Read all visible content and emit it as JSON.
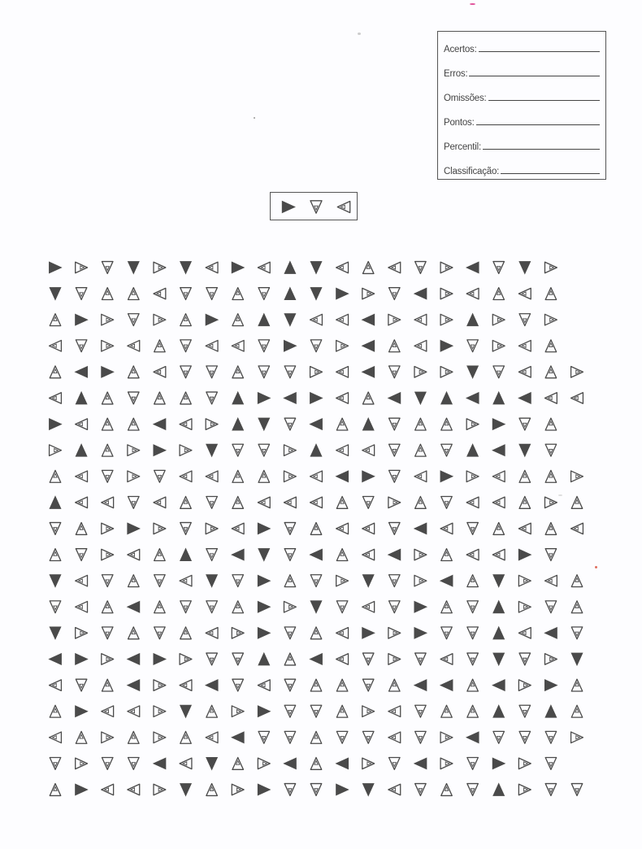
{
  "score_sheet": {
    "fields": [
      {
        "label": "Acertos:"
      },
      {
        "label": "Erros:"
      },
      {
        "label": "Omissões:"
      },
      {
        "label": "Pontos:"
      },
      {
        "label": "Percentil:"
      },
      {
        "label": "Classificação:"
      }
    ]
  },
  "colors": {
    "ink": "#4a4a4a",
    "paper": "#fdfdff",
    "border": "#555555"
  },
  "icon_legend": {
    "R": "filled-right-triangle",
    "L": "filled-left-triangle",
    "U": "filled-up-triangle",
    "D": "filled-down-triangle",
    "r": "outline-right-triangle-with-dot",
    "l": "outline-left-triangle-with-dot",
    "u": "outline-up-triangle-with-dot",
    "d": "outline-down-triangle-with-dot"
  },
  "model_targets": [
    "R",
    "d",
    "l"
  ],
  "grid": [
    "RrdDrDlRlUDluldrLdDr",
    "DduulddudUDRrdLrlulu",
    "uRrdruRuUDllLrlrUrdr",
    "ldrludlldRdrLulRdrlu",
    "uLRuldduddrlLdrrDdlurl",
    "lUuduudURLRluLDULULll",
    "RluuLlrUDdLuUduurRdu",
    "rUurRrDddrUlldudULDd",
    "uldrdlluurlLRdlRrluurL",
    "Ulldludullludrudlluru",
    "durRrdrlRdulldLldululrU",
    "udrluUdLDdLulLrullRd",
    "DldudlDdRudrDdrLuDrlu",
    "dluLudduRrDdldRudUrdud",
    "DrdudulrRdulRrRddUlLd",
    "LRrLRrddUuLldrdldDdrD",
    "lduLrlLdlduuduLLuLrRu",
    "uRllrDurRddurlduuUdUu",
    "lururulLdduddldrLdddr",
    "drddLlDurLuLrdLrdRrd",
    "uRllrDurRddRDldudUrdd"
  ]
}
